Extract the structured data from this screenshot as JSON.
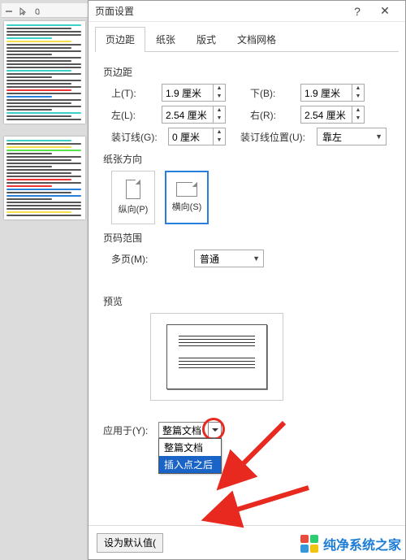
{
  "dialog": {
    "title": "页面设置",
    "help": "?",
    "close": "✕"
  },
  "tabs": {
    "margins": "页边距",
    "paper": "纸张",
    "layout": "版式",
    "grid": "文档网格"
  },
  "margins": {
    "section": "页边距",
    "top_label": "上(T):",
    "top_value": "1.9 厘米",
    "bottom_label": "下(B):",
    "bottom_value": "1.9 厘米",
    "left_label": "左(L):",
    "left_value": "2.54 厘米",
    "right_label": "右(R):",
    "right_value": "2.54 厘米",
    "gutter_label": "装订线(G):",
    "gutter_value": "0 厘米",
    "gutter_pos_label": "装订线位置(U):",
    "gutter_pos_value": "靠左"
  },
  "orientation": {
    "section": "纸张方向",
    "portrait": "纵向(P)",
    "landscape": "横向(S)"
  },
  "pages": {
    "section": "页码范围",
    "multi_label": "多页(M):",
    "multi_value": "普通"
  },
  "preview": {
    "section": "预览"
  },
  "apply": {
    "label": "应用于(Y):",
    "value": "整篇文档",
    "options": {
      "whole": "整篇文档",
      "after": "插入点之后"
    }
  },
  "footer": {
    "default": "设为默认值("
  },
  "watermark": "纯净系统之家",
  "colors": {
    "accent": "#2a7edb",
    "highlight_arrow": "#e8291f",
    "select_hi": "#1a63c7"
  }
}
